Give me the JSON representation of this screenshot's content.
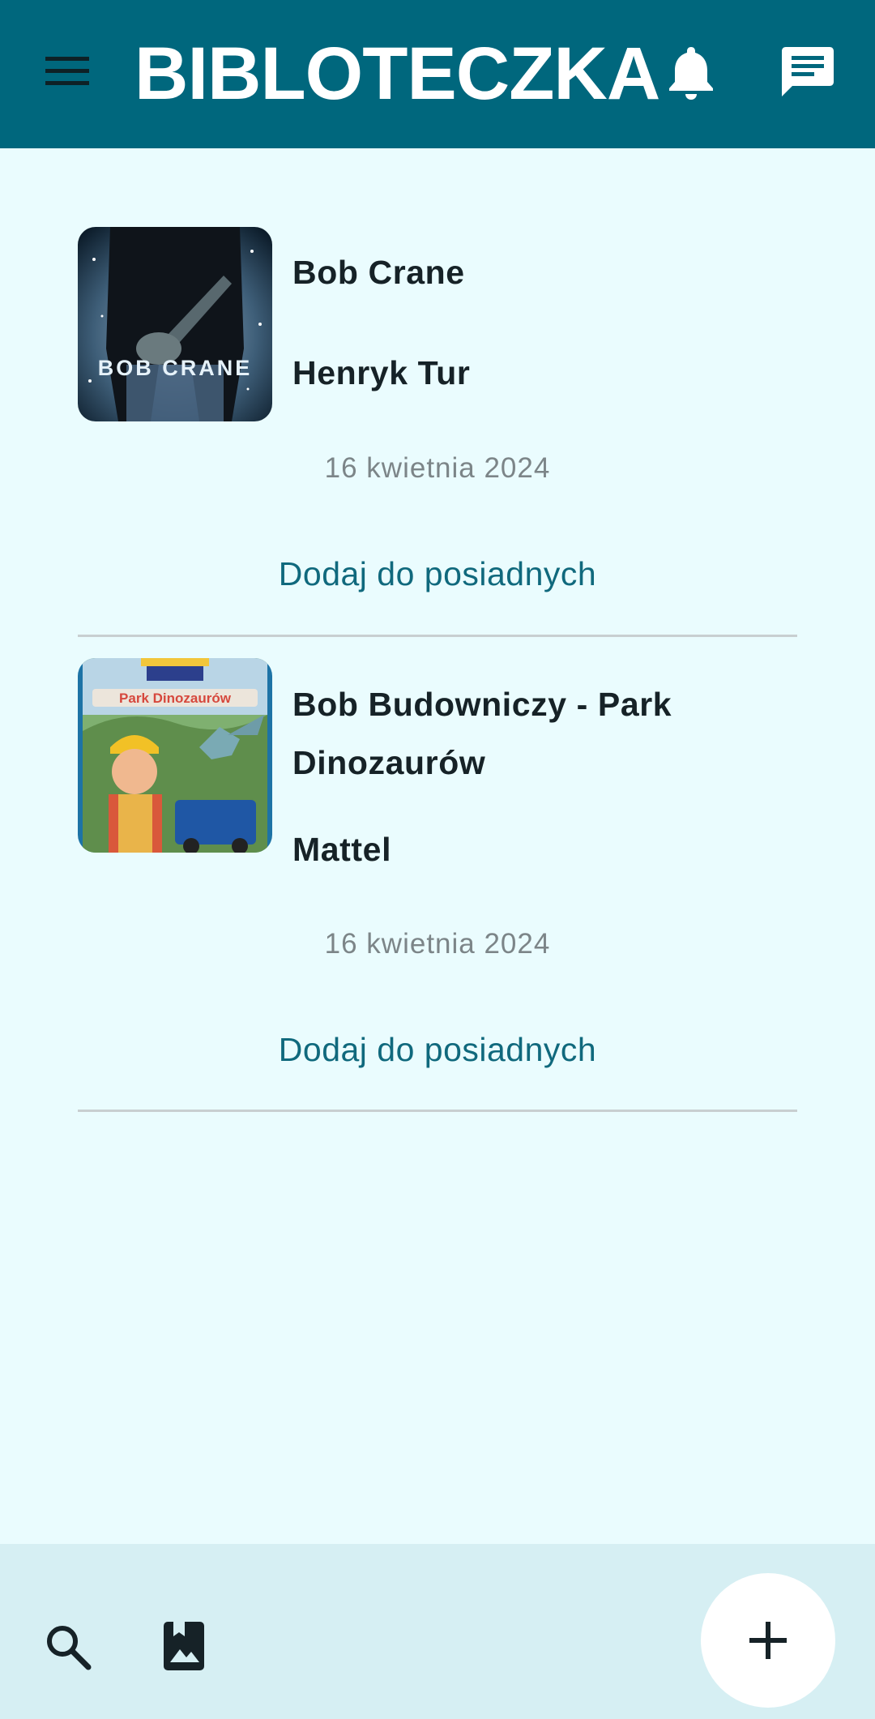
{
  "app": {
    "title": "BIBLOTECZKA"
  },
  "topbar": {
    "icons": {
      "menu": "menu-icon",
      "notifications": "bell-icon",
      "messages": "chat-icon"
    }
  },
  "books": [
    {
      "title": "Bob Crane",
      "author": "Henryk Tur",
      "date": "16 kwietnia 2024",
      "action": "Dodaj do posiadnych",
      "cover_text": "BOB CRANE"
    },
    {
      "title": "Bob Budowniczy - Park Dinozaurów",
      "author": "Mattel",
      "date": "16 kwietnia 2024",
      "action": "Dodaj do posiadnych",
      "cover_text": "Park Dinozaurów"
    }
  ],
  "bottombar": {
    "icons": {
      "search": "search-icon",
      "gallery": "photo-album-icon",
      "add": "plus-icon"
    }
  },
  "colors": {
    "primary": "#00677D",
    "background": "#EAFCFE",
    "bottombar": "#D6EFF3",
    "link": "#10697D",
    "text": "#162227",
    "muted": "#7C8588"
  }
}
